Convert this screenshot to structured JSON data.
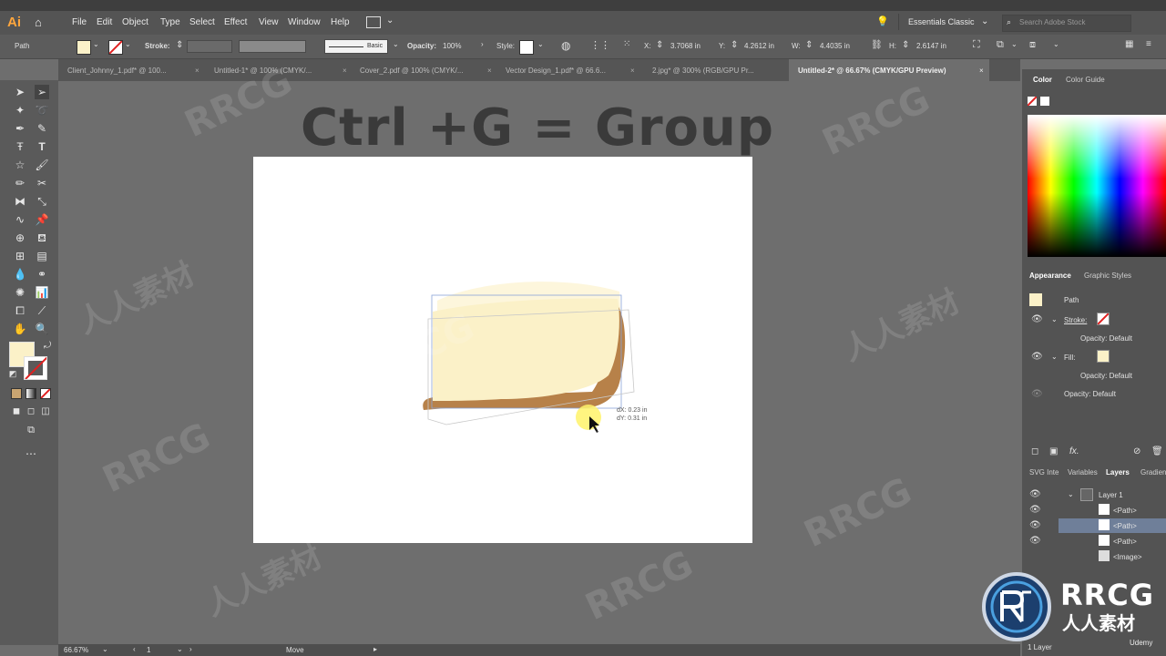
{
  "app": {
    "logo": "Ai",
    "workspace": "Essentials Classic",
    "search_placeholder": "Search Adobe Stock"
  },
  "menu": [
    "File",
    "Edit",
    "Object",
    "Type",
    "Select",
    "Effect",
    "View",
    "Window",
    "Help"
  ],
  "control": {
    "selection_type": "Path",
    "stroke_label": "Stroke:",
    "brush_label": "Basic",
    "opacity_label": "Opacity:",
    "opacity_value": "100%",
    "style_label": "Style:",
    "x_label": "X:",
    "x_value": "3.7068 in",
    "y_label": "Y:",
    "y_value": "4.2612 in",
    "w_label": "W:",
    "w_value": "4.4035 in",
    "h_label": "H:",
    "h_value": "2.6147 in"
  },
  "tabs": [
    "Client_Johnny_1.pdf* @ 100...",
    "Untitled-1* @ 100% (CMYK/...",
    "Cover_2.pdf @ 100% (CMYK/...",
    "Vector Design_1.pdf* @ 66.6...",
    "2.jpg* @ 300% (RGB/GPU Pr...",
    "Untitled-2* @ 66.67% (CMYK/GPU Preview)"
  ],
  "headline": "Ctrl +G = Group",
  "move_readout": {
    "dx": "dX: 0.23 in",
    "dy": "dY: 0.31 in"
  },
  "color_panel": {
    "tab1": "Color",
    "tab2": "Color Guide"
  },
  "appearance": {
    "tab1": "Appearance",
    "tab2": "Graphic Styles",
    "title": "Path",
    "stroke": "Stroke:",
    "stroke_opacity": "Opacity: Default",
    "fill": "Fill:",
    "fill_opacity": "Opacity: Default",
    "opacity": "Opacity: Default",
    "fx": "fx."
  },
  "layers_panel": {
    "tabs": [
      "SVG Inte",
      "Variables",
      "Layers",
      "Gradien"
    ],
    "layer_name": "Layer 1",
    "items": [
      "<Path>",
      "<Path>",
      "<Path>",
      "<Image>"
    ],
    "footer": "1 Layer"
  },
  "status": {
    "zoom": "66.67%",
    "artboard": "1",
    "tool": "Move"
  },
  "colors": {
    "fill": "#fbf1c8",
    "crust": "#b78149",
    "accent": "#ffa63d"
  },
  "watermarks": {
    "brand": "RRCG",
    "cn": "人人素材",
    "corner_sub": "人人素材",
    "udemy": "Udemy"
  }
}
